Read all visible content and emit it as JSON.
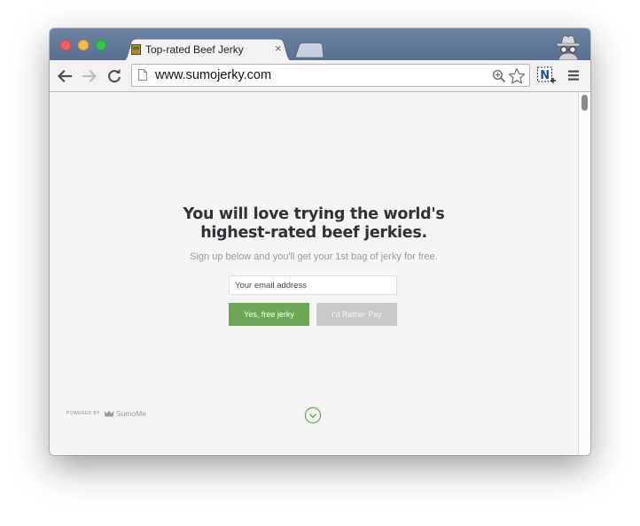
{
  "browser": {
    "tab": {
      "title": "Top-rated Beef Jerky",
      "close_glyph": "×",
      "favicon": "jerky-favicon-icon"
    },
    "address_bar": {
      "url": "www.sumojerky.com"
    },
    "icons": {
      "back": "back-arrow-icon",
      "forward": "forward-arrow-icon",
      "reload": "reload-icon",
      "page": "page-icon",
      "zoom": "zoom-icon",
      "bookmark": "star-icon",
      "extension": "extension-n-icon",
      "menu": "hamburger-menu-icon",
      "incognito": "incognito-icon"
    },
    "extension_label": "N"
  },
  "page": {
    "headline_line1": "You will love trying the world's",
    "headline_line2": "highest-rated beef jerkies.",
    "subtext": "Sign up below and you'll get your 1st bag of jerky for free.",
    "email_placeholder": "Your email address",
    "primary_button": "Yes, free jerky",
    "secondary_button": "I'd Rather Pay",
    "powered_by": "POWERED BY",
    "brand": "SumoMe",
    "scroll_icon": "chevron-down-circle-icon"
  },
  "colors": {
    "titlebar": "#5f7596",
    "primary_button": "#6ba755",
    "secondary_button": "#c8c9c8",
    "page_background": "#f4f5f4",
    "headline": "#2f3236",
    "accent_circle": "#6ba755"
  }
}
